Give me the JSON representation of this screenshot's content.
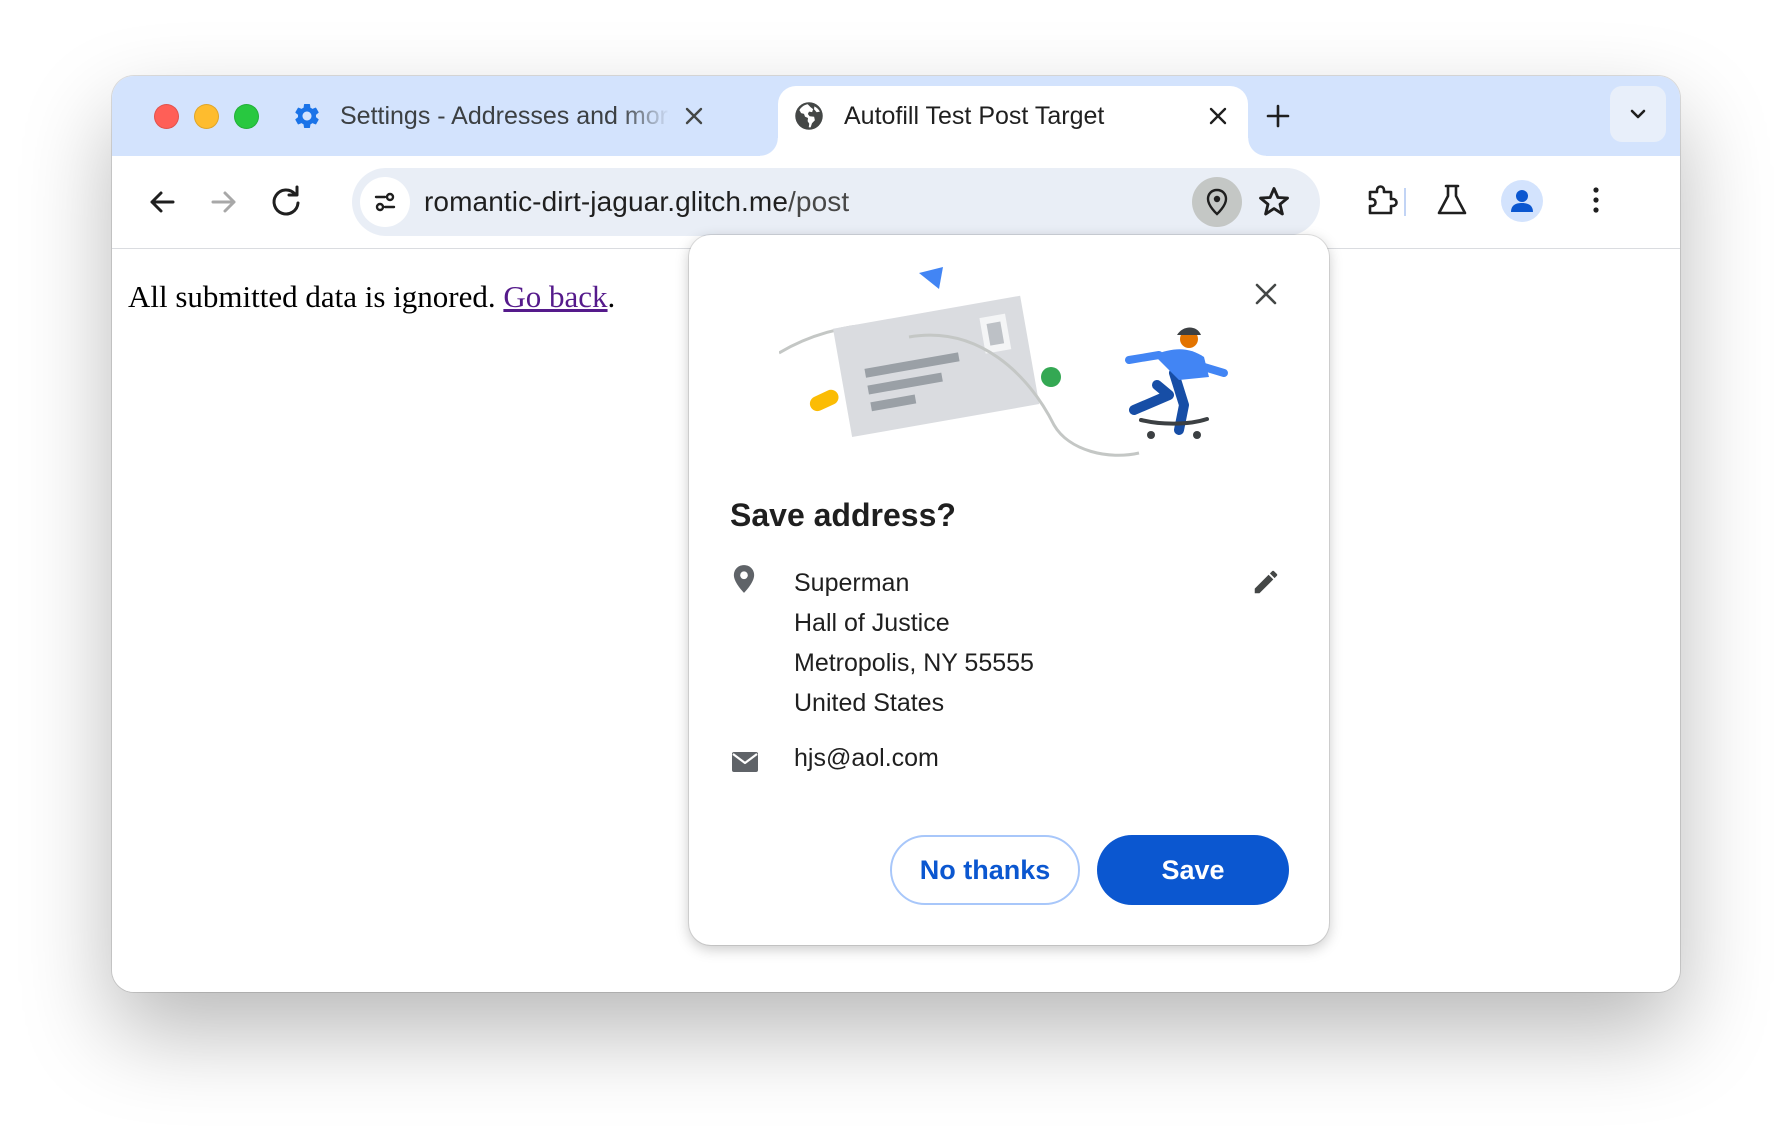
{
  "window": {
    "traffic_lights": {
      "close": "#ff5f57",
      "minimize": "#febc2e",
      "zoom": "#28c840"
    }
  },
  "tabs": [
    {
      "title": "Settings - Addresses and more",
      "favicon": "gear-icon",
      "active": false
    },
    {
      "title": "Autofill Test Post Target",
      "favicon": "globe-icon",
      "active": true
    }
  ],
  "toolbar": {
    "url_host": "romantic-dirt-jaguar.glitch.me",
    "url_path": "/post"
  },
  "page": {
    "text": "All submitted data is ignored. ",
    "link_text": "Go back",
    "suffix": "."
  },
  "save_address_bubble": {
    "title": "Save address?",
    "address_lines": [
      "Superman",
      "Hall of Justice",
      "Metropolis, NY 55555",
      "United States"
    ],
    "email": "hjs@aol.com",
    "no_thanks_label": "No thanks",
    "save_label": "Save"
  },
  "colors": {
    "tabstrip": "#d3e3fd",
    "accent": "#0b57d0",
    "link_visited": "#551a8b"
  }
}
